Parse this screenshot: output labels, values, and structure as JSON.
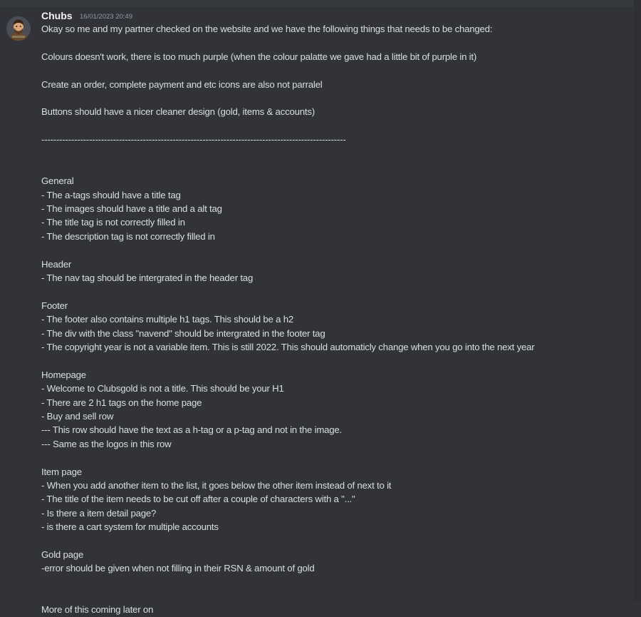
{
  "message": {
    "username": "Chubs",
    "timestamp": "16/01/2023 20:49",
    "avatar_icon": "user-avatar-icon",
    "lines": [
      "Okay so me and my partner checked on the website and we have the following things that needs to be changed:",
      "",
      "Colours doesn't work, there is too much purple (when the colour palatte we gave had a little bit of purple in it)",
      "",
      "Create an order, complete payment and etc icons are also not parralel",
      "",
      "Buttons should have a nicer cleaner design (gold, items & accounts)",
      "",
      "------------------------------------------------------------------------------------------------------",
      "",
      "",
      "General",
      "- The a-tags should have a title tag",
      "- The images should have a title and a alt tag",
      "- The title tag is not correctly filled in",
      "- The description tag is not correctly filled in",
      "",
      "Header",
      "- The nav tag should be intergrated in the header tag",
      "",
      "Footer",
      "- The footer also contains multiple h1 tags. This should be a h2",
      "- The div with the class \"navend\" should be intergrated in the footer tag",
      "- The copyright year is not a variable item. This is still 2022. This should automaticly change when you go into the next year",
      "",
      "Homepage",
      "- Welcome to Clubsgold is not a title. This should be your H1",
      "- There are 2 h1 tags on the home page",
      "- Buy and sell row",
      "--- This row should have the text as a h-tag or a p-tag and not in the image.",
      "--- Same as the logos in this row",
      "",
      "Item page",
      "- When you add another item to the list, it goes below the other item instead of next to it",
      "- The title of the item needs to be cut off after a couple of characters with a \"...\"",
      "- Is there a item detail page?",
      "- is there a cart system for multiple accounts",
      "",
      "Gold page",
      "-error should be given when not filling in their RSN & amount of gold",
      "",
      "",
      "More of this coming later on"
    ]
  },
  "colors": {
    "background": "#313338",
    "text": "#dbdee1",
    "username": "#f2f3f5",
    "timestamp": "#949ba4"
  }
}
